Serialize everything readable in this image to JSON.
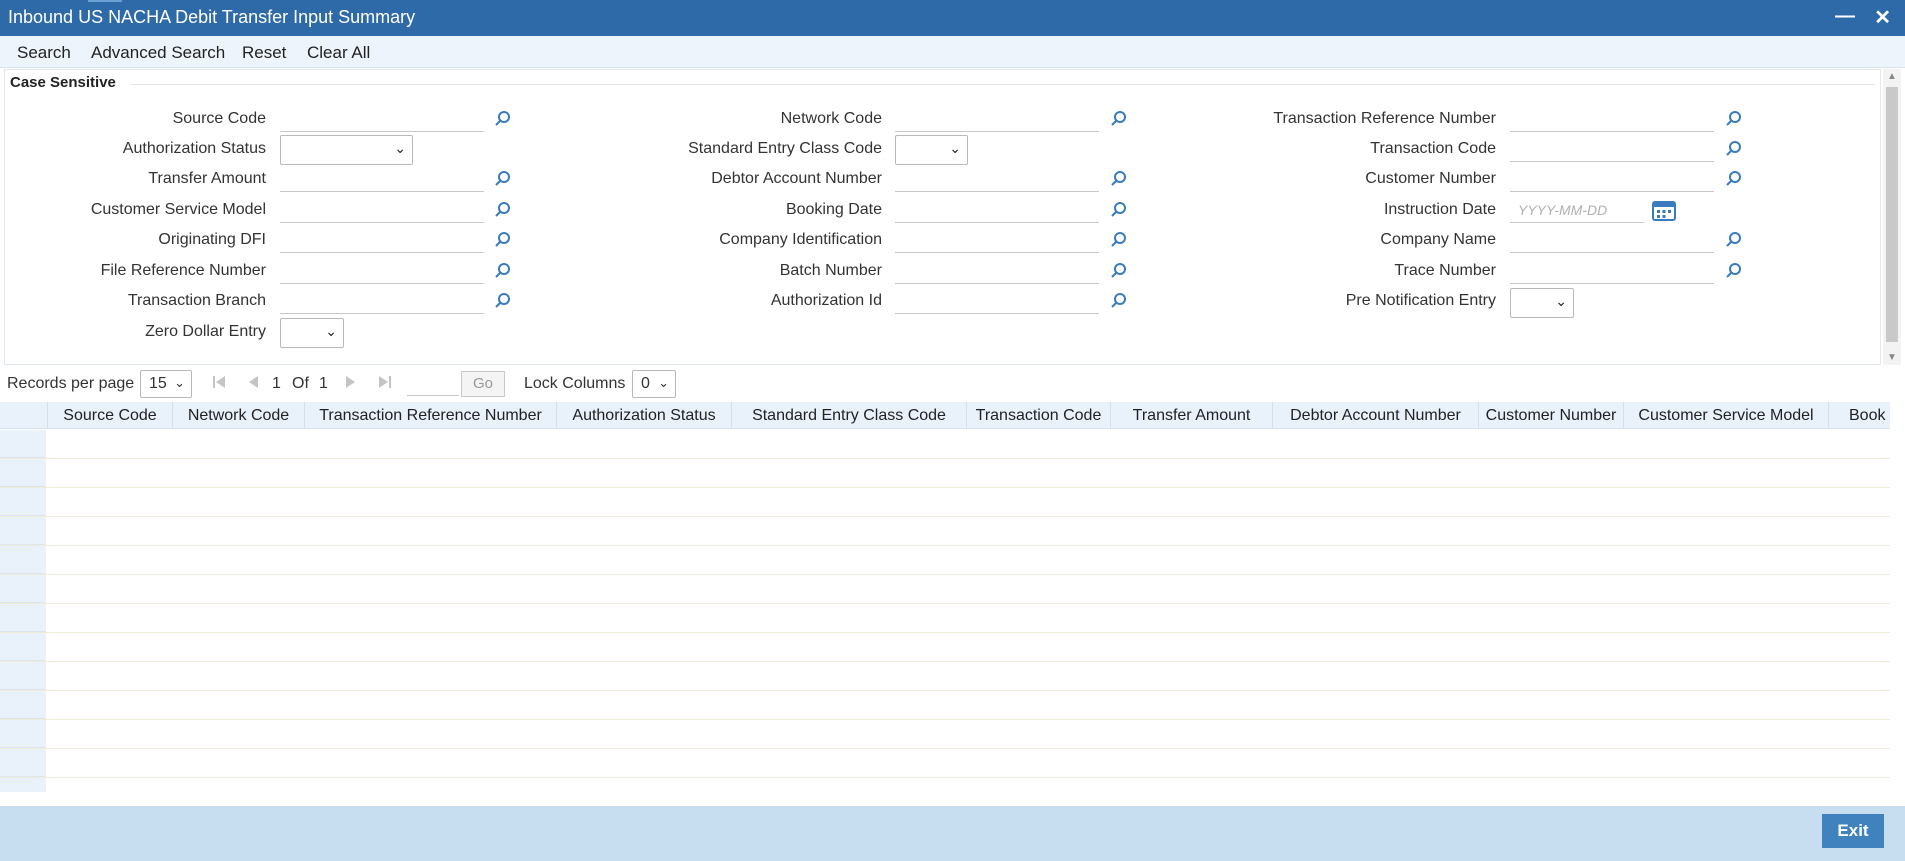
{
  "window": {
    "title": "Inbound US NACHA Debit Transfer Input Summary"
  },
  "menu": {
    "search": "Search",
    "advanced_search": "Advanced Search",
    "reset": "Reset",
    "clear_all": "Clear All"
  },
  "section": {
    "label": "Case Sensitive"
  },
  "fields": {
    "source_code": "Source Code",
    "authorization_status": "Authorization Status",
    "transfer_amount": "Transfer Amount",
    "customer_service_model": "Customer Service Model",
    "originating_dfi": "Originating DFI",
    "file_reference_number": "File Reference Number",
    "transaction_branch": "Transaction Branch",
    "zero_dollar_entry": "Zero Dollar Entry",
    "network_code": "Network Code",
    "standard_entry_class_code": "Standard Entry Class Code",
    "debtor_account_number": "Debtor Account Number",
    "booking_date": "Booking Date",
    "company_identification": "Company Identification",
    "batch_number": "Batch Number",
    "authorization_id": "Authorization Id",
    "transaction_reference_number": "Transaction Reference Number",
    "transaction_code": "Transaction Code",
    "customer_number": "Customer Number",
    "instruction_date": "Instruction Date",
    "instruction_date_placeholder": "YYYY-MM-DD",
    "company_name": "Company Name",
    "trace_number": "Trace Number",
    "pre_notification_entry": "Pre Notification Entry"
  },
  "pager": {
    "records_per_page_label": "Records per page",
    "records_per_page": "15",
    "current_page": "1",
    "of_label": "Of",
    "total_pages": "1",
    "go": "Go",
    "lock_columns_label": "Lock Columns",
    "lock_columns": "0"
  },
  "grid": {
    "columns": [
      "Source Code",
      "Network Code",
      "Transaction Reference Number",
      "Authorization Status",
      "Standard Entry Class Code",
      "Transaction Code",
      "Transfer Amount",
      "Debtor Account Number",
      "Customer Number",
      "Customer Service Model",
      "Book"
    ]
  },
  "footer": {
    "exit": "Exit"
  },
  "colors": {
    "titlebar": "#2f6aa8",
    "accent": "#3f82bd",
    "footer": "#c7ddf0",
    "lookup_icon": "#3a7bbf"
  }
}
